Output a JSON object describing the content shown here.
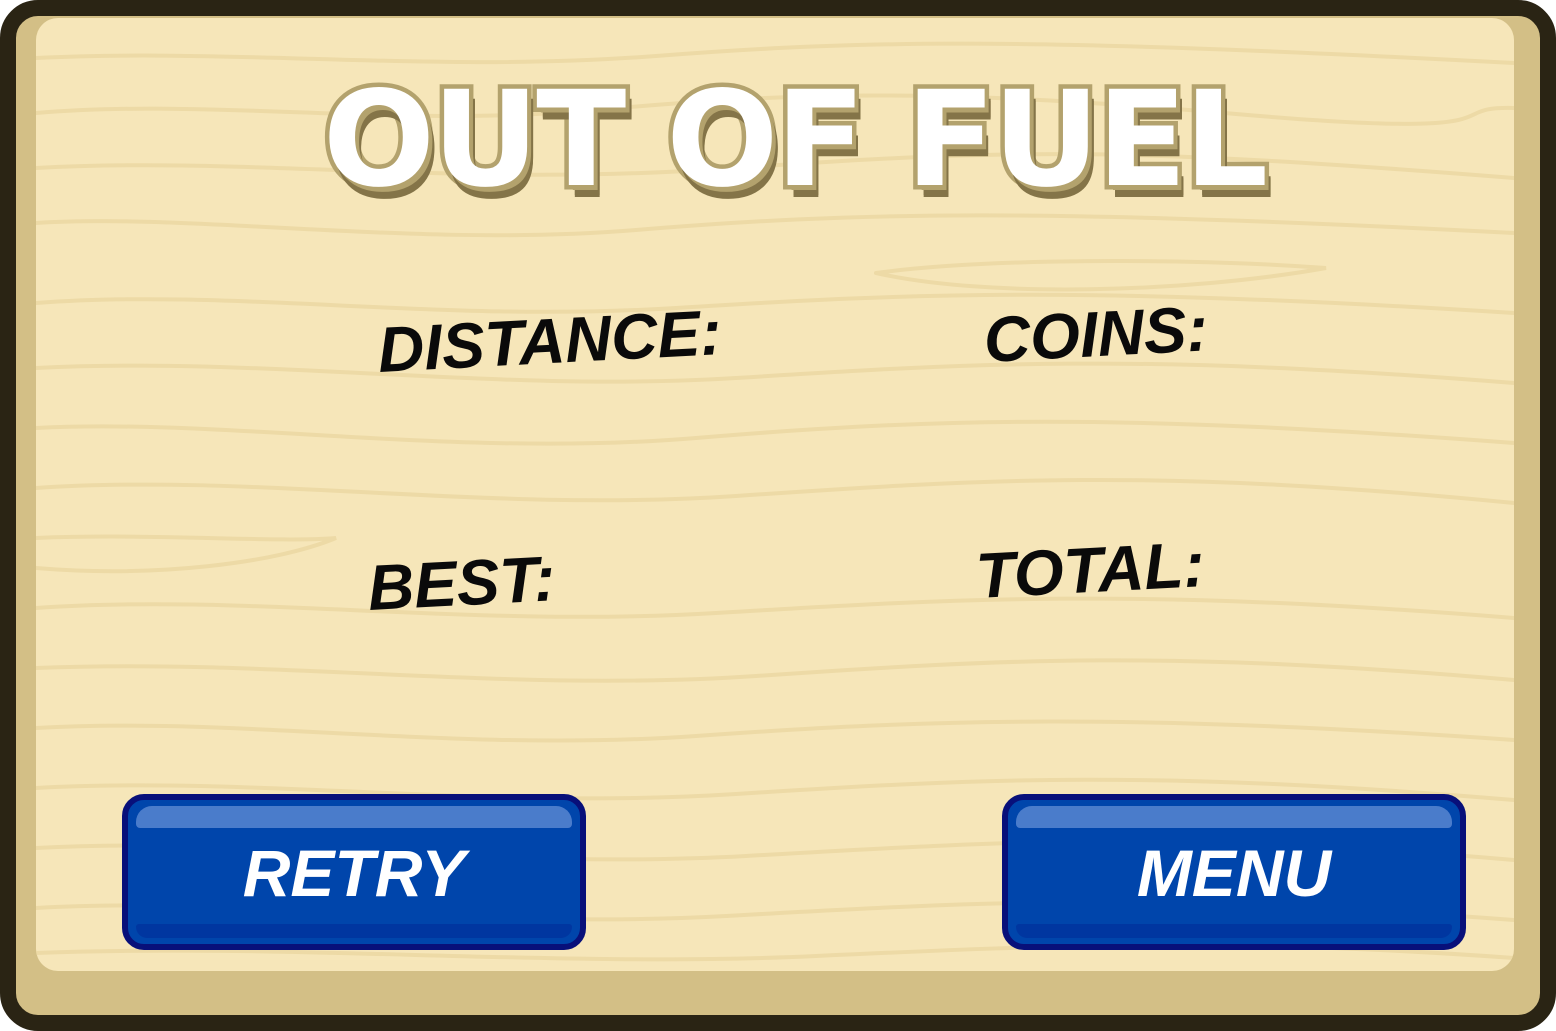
{
  "dialog": {
    "title": "OUT OF FUEL"
  },
  "stats": {
    "distance_label": "DISTANCE:",
    "coins_label": "COINS:",
    "best_label": "BEST:",
    "total_label": "TOTAL:"
  },
  "buttons": {
    "retry_label": "RETRY",
    "menu_label": "MENU"
  },
  "colors": {
    "frame": "#2a2414",
    "board": "#f6e6b9",
    "board_edge": "#d3bf86",
    "title_fill": "#ffffff",
    "title_outline": "#b3a26d",
    "button_fill": "#0045ab",
    "button_border": "#08107a"
  }
}
